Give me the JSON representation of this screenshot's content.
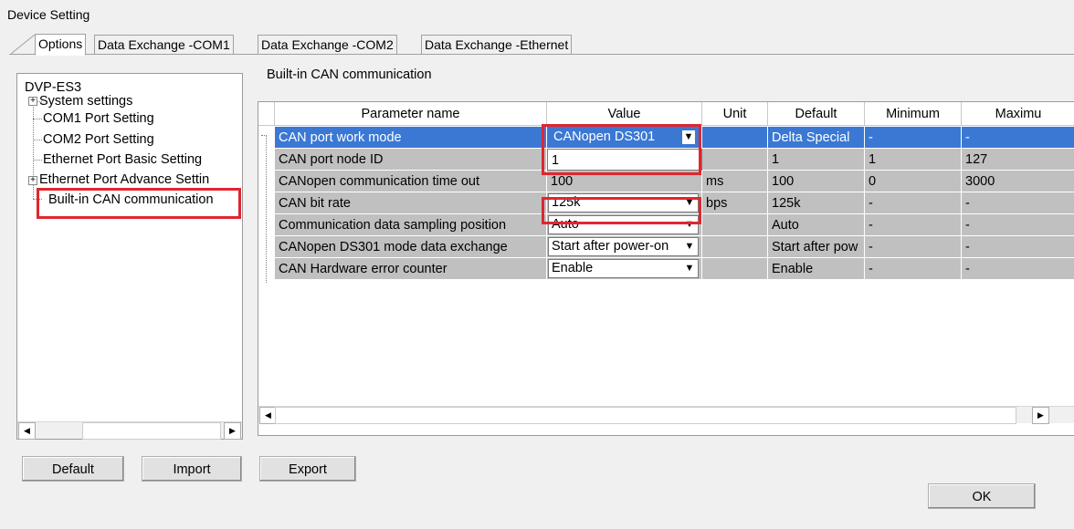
{
  "window": {
    "title": "Device Setting"
  },
  "tabs": [
    {
      "label": "Options",
      "active": true
    },
    {
      "label": "Data Exchange -COM1",
      "active": false
    },
    {
      "label": "Data Exchange -COM2",
      "active": false
    },
    {
      "label": "Data Exchange -Ethernet",
      "active": false
    }
  ],
  "tree": {
    "root": "DVP-ES3",
    "items": [
      {
        "label": "System settings",
        "expandable": true
      },
      {
        "label": "COM1 Port Setting",
        "expandable": false
      },
      {
        "label": "COM2 Port Setting",
        "expandable": false
      },
      {
        "label": "Ethernet Port Basic Setting",
        "expandable": false
      },
      {
        "label": "Ethernet Port Advance Settin",
        "expandable": true
      },
      {
        "label": "Built-in CAN communication",
        "expandable": false,
        "highlighted": true
      }
    ]
  },
  "section_title": "Built-in CAN communication",
  "grid": {
    "columns": [
      "Parameter name",
      "Value",
      "Unit",
      "Default",
      "Minimum",
      "Maximu"
    ],
    "rows": [
      {
        "name": "CAN port work mode",
        "value": "CANopen DS301",
        "unit": "",
        "default": "Delta Special",
        "min": "-",
        "max": "-",
        "value_kind": "combo",
        "selected": true
      },
      {
        "name": "CAN port node ID",
        "value": "1",
        "unit": "",
        "default": "1",
        "min": "1",
        "max": "127",
        "value_kind": "edit"
      },
      {
        "name": "CANopen communication time out",
        "value": "100",
        "unit": "ms",
        "default": "100",
        "min": "0",
        "max": "3000",
        "value_kind": "text"
      },
      {
        "name": "CAN bit rate",
        "value": "125k",
        "unit": "bps",
        "default": "125k",
        "min": "-",
        "max": "-",
        "value_kind": "combo"
      },
      {
        "name": "Communication data sampling position",
        "value": "Auto",
        "unit": "",
        "default": "Auto",
        "min": "-",
        "max": "-",
        "value_kind": "combo"
      },
      {
        "name": "CANopen DS301 mode data exchange",
        "value": "Start after power-on",
        "unit": "",
        "default": "Start after pow",
        "min": "-",
        "max": "-",
        "value_kind": "combo"
      },
      {
        "name": "CAN Hardware error counter",
        "value": "Enable",
        "unit": "",
        "default": "Enable",
        "min": "-",
        "max": "-",
        "value_kind": "combo"
      }
    ]
  },
  "buttons": {
    "default": "Default",
    "import": "Import",
    "export": "Export",
    "ok": "OK"
  },
  "icons": {
    "expand": "plus-box-icon",
    "scroll_left": "arrow-left-icon",
    "scroll_right": "arrow-right-icon",
    "dropdown": "dropdown-arrow-icon"
  },
  "colors": {
    "selection": "#3a78d4",
    "grid_row": "#c0c0c0",
    "highlight_box": "#e0262f"
  }
}
